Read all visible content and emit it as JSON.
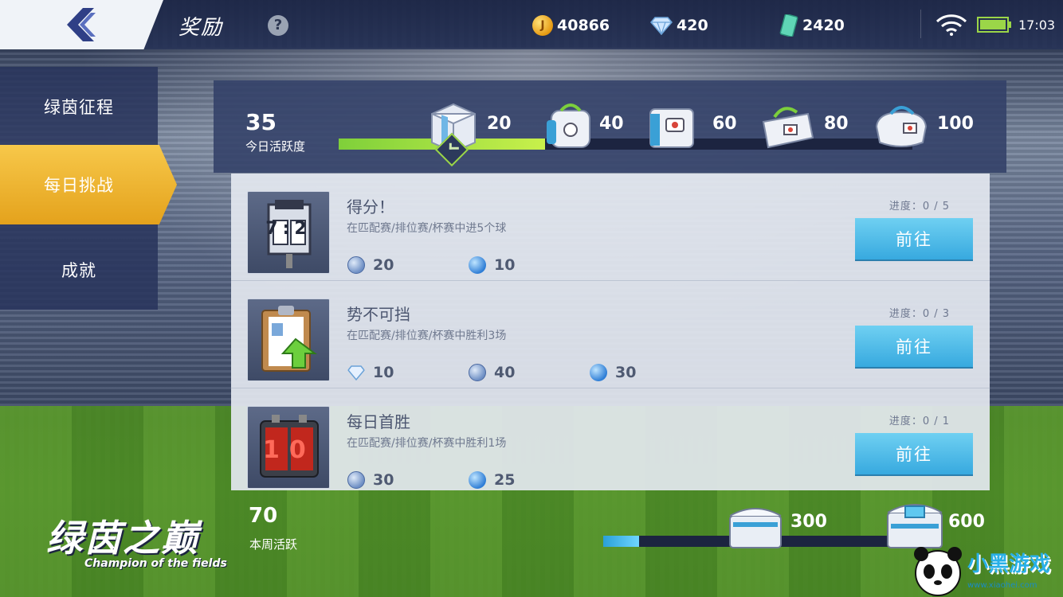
{
  "header": {
    "title": "奖励",
    "help_icon": "help-icon",
    "coins": "40866",
    "diamonds": "420",
    "tickets": "2420",
    "time": "17:03"
  },
  "sidebar": {
    "items": [
      {
        "label": "绿茵征程"
      },
      {
        "label": "每日挑战"
      },
      {
        "label": "成就"
      }
    ],
    "active_index": 1
  },
  "daily_activity": {
    "value": "35",
    "label": "今日活跃度",
    "progress_fraction": 0.36,
    "milestones": [
      {
        "value": "20",
        "claimed": true
      },
      {
        "value": "40"
      },
      {
        "value": "60"
      },
      {
        "value": "80"
      },
      {
        "value": "100"
      }
    ]
  },
  "tasks": [
    {
      "title": "得分！",
      "desc": "在匹配赛/排位赛/杯赛中进5个球",
      "progress": "进度：0 / 5",
      "button": "前往",
      "rewards": [
        {
          "icon": "token-icon",
          "value": "20"
        },
        {
          "icon": "ball-icon",
          "value": "10"
        }
      ],
      "icon_text": "7:2"
    },
    {
      "title": "势不可挡",
      "desc": "在匹配赛/排位赛/杯赛中胜利3场",
      "progress": "进度：0 / 3",
      "button": "前往",
      "rewards": [
        {
          "icon": "diamond-icon",
          "value": "10"
        },
        {
          "icon": "token-icon",
          "value": "40"
        },
        {
          "icon": "ball-icon",
          "value": "30"
        }
      ]
    },
    {
      "title": "每日首胜",
      "desc": "在匹配赛/排位赛/杯赛中胜利1场",
      "progress": "进度：0 / 1",
      "button": "前往",
      "rewards": [
        {
          "icon": "token-icon",
          "value": "30"
        },
        {
          "icon": "ball-icon",
          "value": "25"
        }
      ],
      "icon_text": "10"
    }
  ],
  "weekly_activity": {
    "value": "70",
    "label": "本周活跃",
    "progress_fraction": 0.11,
    "milestones": [
      {
        "value": "300"
      },
      {
        "value": "600"
      }
    ]
  },
  "logo": {
    "cn": "绿茵之巅",
    "en": "Champion of the fields"
  },
  "watermark": {
    "text": "小黑游戏",
    "url": "www.xiaohei.com"
  },
  "colors": {
    "accent_yellow": "#e4a21c",
    "button_blue": "#37a9df",
    "progress_green": "#7fd03a"
  }
}
